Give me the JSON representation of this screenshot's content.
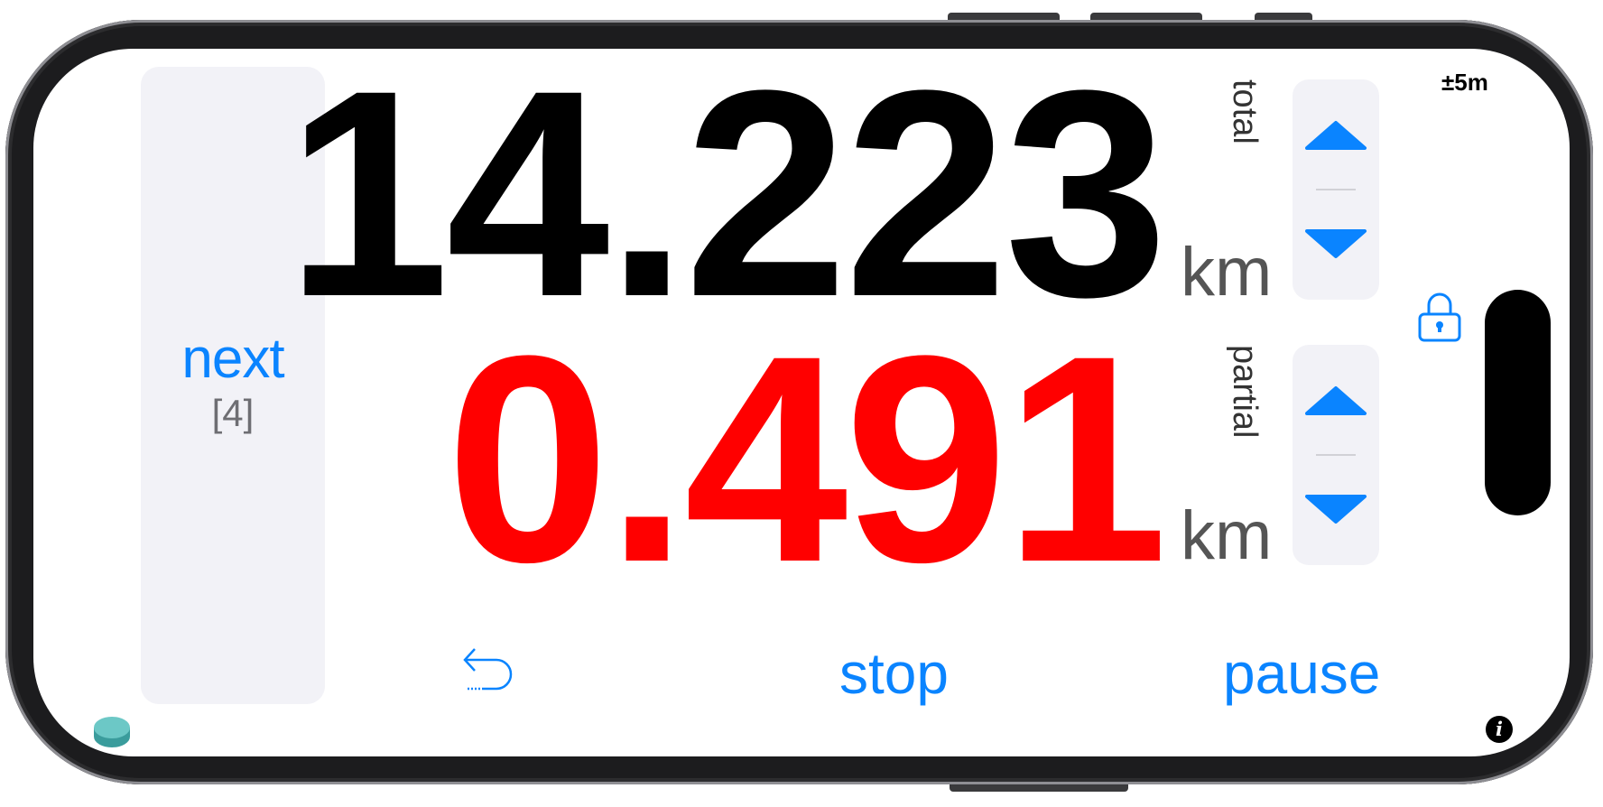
{
  "total": {
    "value": "14.223",
    "unit": "km",
    "label": "total"
  },
  "partial": {
    "value": "0.491",
    "unit": "km",
    "label": "partial"
  },
  "next": {
    "label": "next",
    "count": "[4]"
  },
  "gps": {
    "accuracy": "±5m"
  },
  "controls": {
    "stop_label": "stop",
    "pause_label": "pause"
  },
  "icons": {
    "lock": "lock-icon",
    "undo": "undo-icon",
    "info": "info-icon",
    "up": "triangle-up-icon",
    "down": "triangle-down-icon",
    "logo": "app-logo-icon"
  },
  "colors": {
    "accent": "#0a84ff",
    "total_value": "#000000",
    "partial_value": "#ff0000",
    "panel_bg": "#f2f2f7"
  }
}
